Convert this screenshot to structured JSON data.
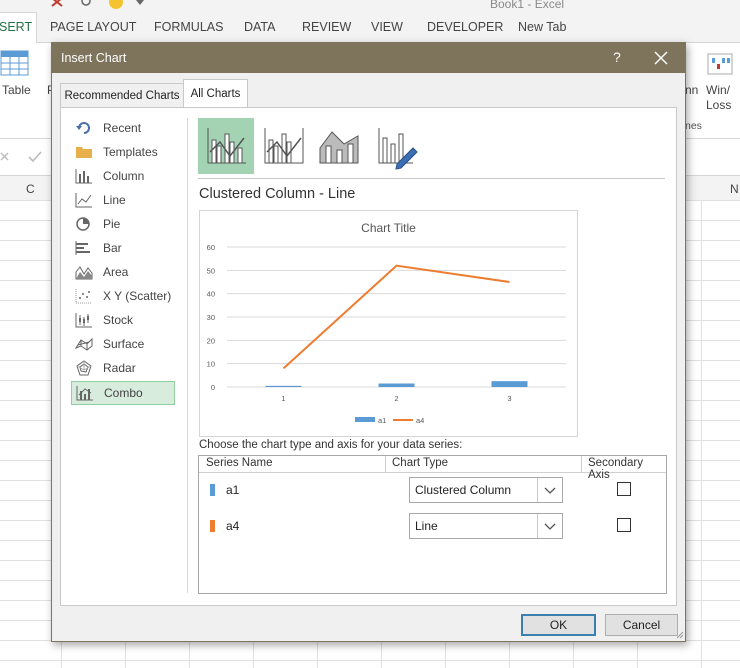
{
  "excel": {
    "title": "Book1 - Excel",
    "tabs": {
      "insert": "SERT",
      "page_layout": "PAGE LAYOUT",
      "formulas": "FORMULAS",
      "data": "DATA",
      "review": "REVIEW",
      "view": "VIEW",
      "developer": "DEVELOPER",
      "new_tab": "New Tab"
    },
    "ribbon": {
      "table": "Table",
      "partial_p": "P",
      "partial_nn": "nn",
      "win_loss_1": "Win/",
      "win_loss_2": "Loss",
      "partial_nes": "nes"
    },
    "columns": {
      "c": "C",
      "n": "N"
    }
  },
  "dialog": {
    "title": "Insert Chart",
    "help": "?",
    "tabs": {
      "recommended": "Recommended Charts",
      "all": "All Charts"
    },
    "categories": [
      {
        "label": "Recent",
        "icon": "recent-icon"
      },
      {
        "label": "Templates",
        "icon": "templates-folder-icon"
      },
      {
        "label": "Column",
        "icon": "column-chart-icon"
      },
      {
        "label": "Line",
        "icon": "line-chart-icon"
      },
      {
        "label": "Pie",
        "icon": "pie-chart-icon"
      },
      {
        "label": "Bar",
        "icon": "bar-chart-icon"
      },
      {
        "label": "Area",
        "icon": "area-chart-icon"
      },
      {
        "label": "X Y (Scatter)",
        "icon": "scatter-chart-icon"
      },
      {
        "label": "Stock",
        "icon": "stock-chart-icon"
      },
      {
        "label": "Surface",
        "icon": "surface-chart-icon"
      },
      {
        "label": "Radar",
        "icon": "radar-chart-icon"
      },
      {
        "label": "Combo",
        "icon": "combo-chart-icon",
        "selected": true
      }
    ],
    "subtype_heading": "Clustered Column - Line",
    "series_caption": "Choose the chart type and axis for your data series:",
    "table_headers": {
      "name": "Series Name",
      "type": "Chart Type",
      "axis": "Secondary Axis"
    },
    "series": [
      {
        "name": "a1",
        "chart_type": "Clustered Column",
        "secondary_axis": false,
        "color": "#5b9bd5"
      },
      {
        "name": "a4",
        "chart_type": "Line",
        "secondary_axis": false,
        "color": "#ed7d31"
      }
    ],
    "buttons": {
      "ok": "OK",
      "cancel": "Cancel"
    }
  },
  "chart_data": {
    "type": "combo",
    "title": "Chart Title",
    "categories": [
      "1",
      "2",
      "3"
    ],
    "ylim": [
      0,
      60
    ],
    "yticks": [
      0,
      10,
      20,
      30,
      40,
      50,
      60
    ],
    "series": [
      {
        "name": "a1",
        "type": "bar",
        "values": [
          0.5,
          1.5,
          2.5
        ],
        "color": "#5b9bd5"
      },
      {
        "name": "a4",
        "type": "line",
        "values": [
          8,
          52,
          45
        ],
        "color": "#ed7d31"
      }
    ],
    "legend": "bottom",
    "grid": true
  }
}
